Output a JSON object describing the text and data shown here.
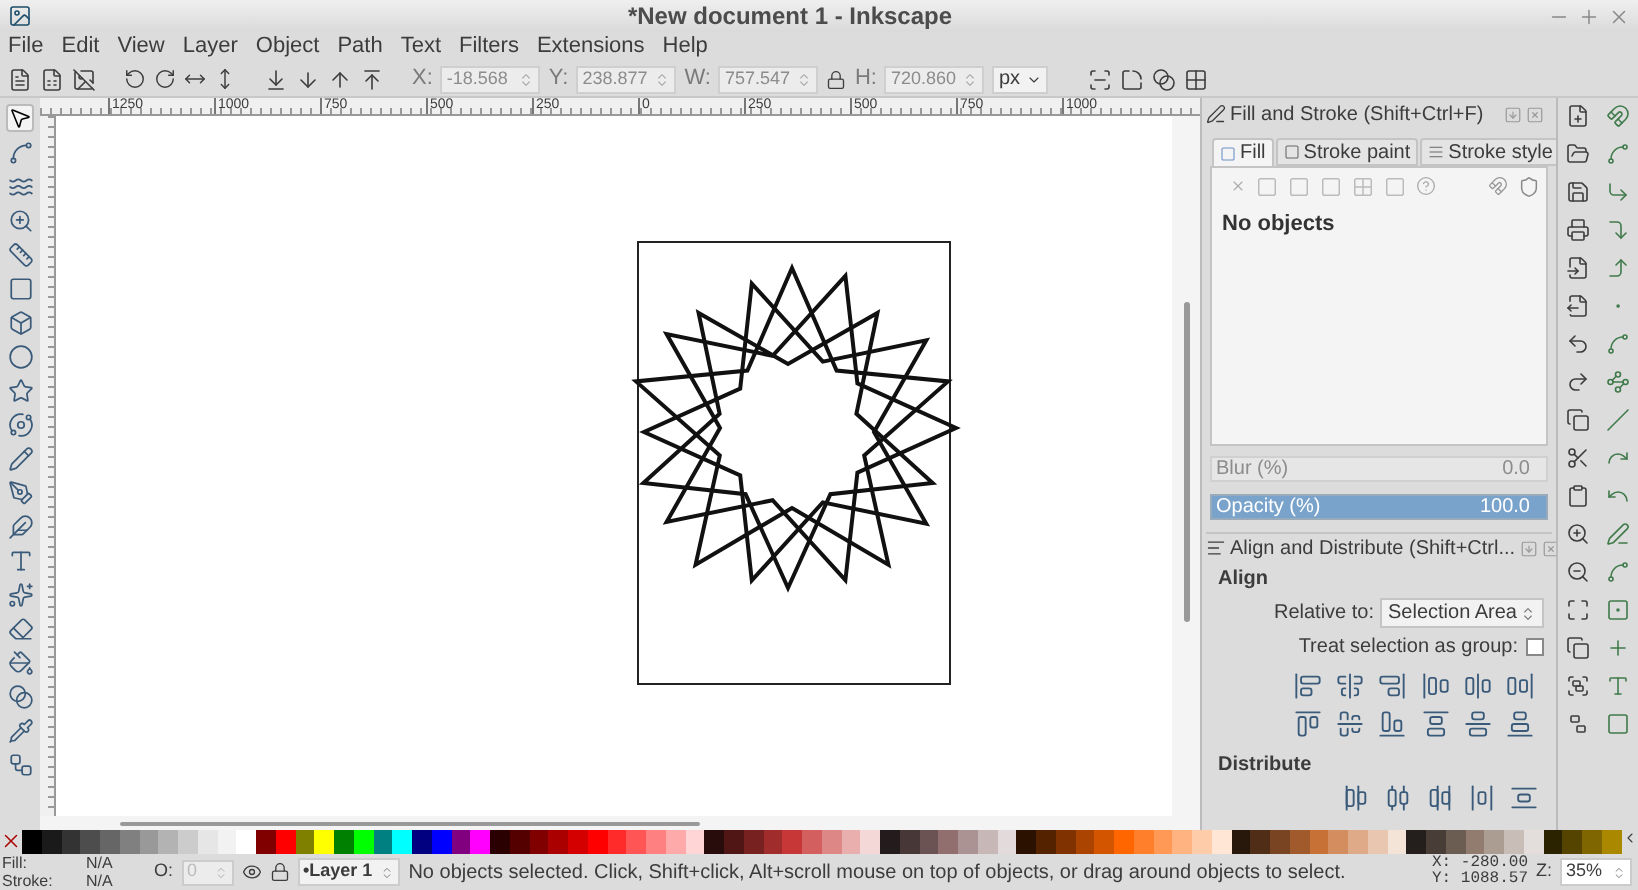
{
  "window": {
    "title": "*New document 1 - Inkscape"
  },
  "menu": [
    "File",
    "Edit",
    "View",
    "Layer",
    "Object",
    "Path",
    "Text",
    "Filters",
    "Extensions",
    "Help"
  ],
  "toolbar": {
    "fields": [
      {
        "label": "X:",
        "value": "-18.568",
        "disabled": true
      },
      {
        "label": "Y:",
        "value": "238.877",
        "disabled": true
      },
      {
        "label": "W:",
        "value": "757.547",
        "disabled": true
      },
      {
        "label": "H:",
        "value": "720.860",
        "disabled": true
      }
    ],
    "unit": "px"
  },
  "ruler": [
    "1250",
    "1000",
    "750",
    "500",
    "250",
    "0",
    "250",
    "500",
    "750",
    "1000"
  ],
  "fill_and_stroke": {
    "title": "Fill and Stroke (Shift+Ctrl+F)",
    "tabs": [
      {
        "label": "Fill",
        "selected": true
      },
      {
        "label": "Stroke paint",
        "selected": false
      },
      {
        "label": "Stroke style",
        "selected": false
      }
    ],
    "message": "No objects",
    "blur": {
      "label": "Blur (%)",
      "reading": "0.0",
      "disabled": true
    },
    "opacity": {
      "label": "Opacity (%)",
      "reading": "100.0",
      "level": 1
    }
  },
  "align_and_distribute": {
    "title": "Align and Distribute (Shift+Ctrl...",
    "align_heading": "Align",
    "relative_to": {
      "label": "Relative to:",
      "value": "Selection Area"
    },
    "treat_as_group": {
      "label": "Treat selection as group:",
      "checked": false
    },
    "distribute_heading": "Distribute"
  },
  "palette": [
    {
      "color": "#000000"
    },
    {
      "color": "#1a1a1a"
    },
    {
      "color": "#333333"
    },
    {
      "color": "#4d4d4d"
    },
    {
      "color": "#666666"
    },
    {
      "color": "#808080"
    },
    {
      "color": "#999999"
    },
    {
      "color": "#b3b3b3"
    },
    {
      "color": "#cccccc"
    },
    {
      "color": "#e6e6e6"
    },
    {
      "color": "#f2f2f2"
    },
    {
      "color": "#ffffff"
    },
    {
      "color": "#800000"
    },
    {
      "color": "#ff0000"
    },
    {
      "color": "#808000"
    },
    {
      "color": "#ffff00"
    },
    {
      "color": "#008000"
    },
    {
      "color": "#00ff00"
    },
    {
      "color": "#008080"
    },
    {
      "color": "#00ffff"
    },
    {
      "color": "#000080"
    },
    {
      "color": "#0000ff"
    },
    {
      "color": "#800080"
    },
    {
      "color": "#ff00ff"
    },
    {
      "color": "#2b0000"
    },
    {
      "color": "#550000"
    },
    {
      "color": "#800000"
    },
    {
      "color": "#aa0000"
    },
    {
      "color": "#d40000"
    },
    {
      "color": "#ff0000"
    },
    {
      "color": "#ff2a2a"
    },
    {
      "color": "#ff5555"
    },
    {
      "color": "#ff8080"
    },
    {
      "color": "#ffaaaa"
    },
    {
      "color": "#ffd5d5"
    },
    {
      "color": "#280b0b"
    },
    {
      "color": "#501616"
    },
    {
      "color": "#782121"
    },
    {
      "color": "#a02c2c"
    },
    {
      "color": "#c83737"
    },
    {
      "color": "#d35f5f"
    },
    {
      "color": "#de8787"
    },
    {
      "color": "#e9afaf"
    },
    {
      "color": "#f4d7d7"
    },
    {
      "color": "#241c1c"
    },
    {
      "color": "#483737"
    },
    {
      "color": "#6c5353"
    },
    {
      "color": "#916f6f"
    },
    {
      "color": "#ac9393"
    },
    {
      "color": "#c8b7b7"
    },
    {
      "color": "#e3dbdb"
    },
    {
      "color": "#2b1100"
    },
    {
      "color": "#552200"
    },
    {
      "color": "#803300"
    },
    {
      "color": "#aa4400"
    },
    {
      "color": "#d45500"
    },
    {
      "color": "#ff6600"
    },
    {
      "color": "#ff7f2a"
    },
    {
      "color": "#ff9955"
    },
    {
      "color": "#ffb380"
    },
    {
      "color": "#ffccaa"
    },
    {
      "color": "#ffe6d5"
    },
    {
      "color": "#28170b"
    },
    {
      "color": "#502d16"
    },
    {
      "color": "#784421"
    },
    {
      "color": "#a05a2c"
    },
    {
      "color": "#c87137"
    },
    {
      "color": "#d38d5f"
    },
    {
      "color": "#deaa87"
    },
    {
      "color": "#e9c6af"
    },
    {
      "color": "#f4e3d7"
    },
    {
      "color": "#241f1c"
    },
    {
      "color": "#483e37"
    },
    {
      "color": "#6c5d53"
    },
    {
      "color": "#917c6f"
    },
    {
      "color": "#ac9d93"
    },
    {
      "color": "#c8beb7"
    },
    {
      "color": "#e3dedb"
    },
    {
      "color": "#2b2200"
    },
    {
      "color": "#554400"
    },
    {
      "color": "#806600"
    },
    {
      "color": "#aa8800"
    }
  ],
  "status_bar": {
    "fill": {
      "label": "Fill:",
      "value": "N/A"
    },
    "stroke": {
      "label": "Stroke:",
      "value": "N/A"
    },
    "opacity": {
      "label": "O:",
      "value": "0"
    },
    "layer": "•Layer 1",
    "message": "No objects selected. Click, Shift+click, Alt+scroll mouse on top of objects, or drag around objects to select.",
    "cursor_x": "X: -280.00",
    "cursor_y": "Y: 1088.57",
    "zoom": {
      "label": "Z:",
      "value": "35%"
    }
  }
}
